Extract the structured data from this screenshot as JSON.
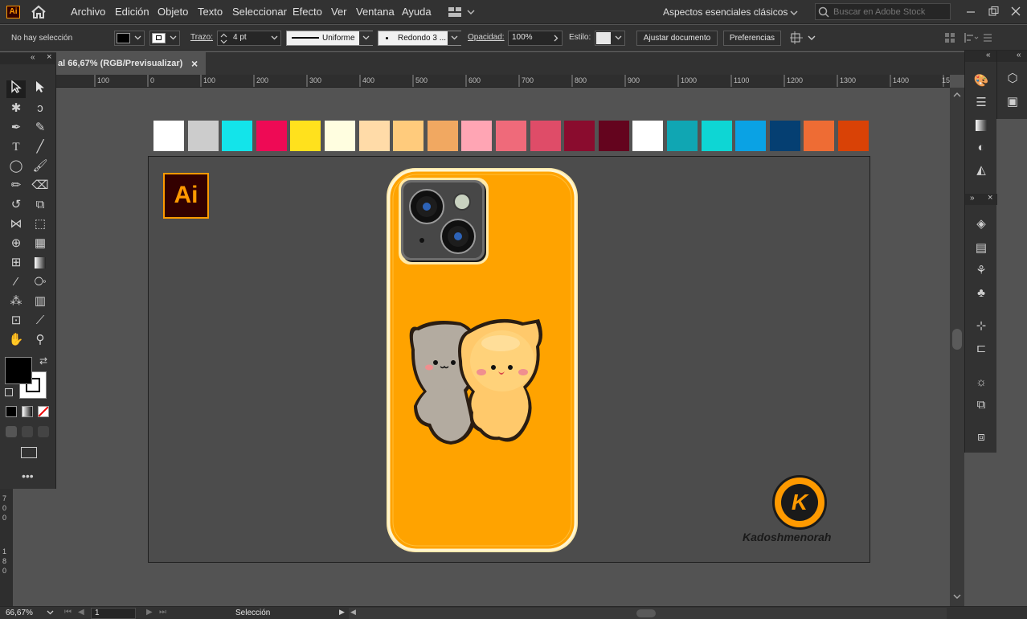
{
  "app": {
    "logo": "Ai"
  },
  "menu": [
    "Archivo",
    "Edición",
    "Objeto",
    "Texto",
    "Seleccionar",
    "Efecto",
    "Ver",
    "Ventana",
    "Ayuda"
  ],
  "workspace": "Aspectos esenciales clásicos",
  "search": {
    "placeholder": "Buscar en Adobe Stock"
  },
  "control": {
    "selection": "No hay selección",
    "stroke_label": "Trazo:",
    "stroke_value": "4 pt",
    "stroke_profile": "Uniforme",
    "brush": "Redondo 3 ...",
    "opacity_label": "Opacidad:",
    "opacity_value": "100%",
    "style_label": "Estilo:",
    "adjust_button": "Ajustar documento",
    "prefs_button": "Preferencias"
  },
  "tab": {
    "title": "al 66,67% (RGB/Previsualizar)",
    "close": "×"
  },
  "ruler": [
    "100",
    "0",
    "100",
    "200",
    "300",
    "400",
    "500",
    "600",
    "700",
    "800",
    "900",
    "1000",
    "1100",
    "1200",
    "1300",
    "1400",
    "15"
  ],
  "ruler_v": [
    "7",
    "0",
    "0",
    "1",
    "8",
    "0"
  ],
  "swatches": [
    "#ffffff",
    "#cccccc",
    "#13e4ea",
    "#ee0a55",
    "#ffe11d",
    "#fffee0",
    "#ffdba8",
    "#ffcb7c",
    "#f1a861",
    "#ffa5b4",
    "#ef6a7a",
    "#df4c68",
    "#8a0c2e",
    "#64041e",
    "#ffffff",
    "#10a6b3",
    "#0ed6d4",
    "#0aa2e4",
    "#053f72",
    "#ee6c34",
    "#d94206"
  ],
  "canvas": {
    "badge": "Ai",
    "brand_initial": "K",
    "brand_name": "Kadoshmenorah",
    "case_color": "#ffa300"
  },
  "status": {
    "zoom": "66,67%",
    "page": "1",
    "tool": "Selección"
  },
  "icons": {
    "home": "home-icon",
    "search": "search-icon"
  }
}
